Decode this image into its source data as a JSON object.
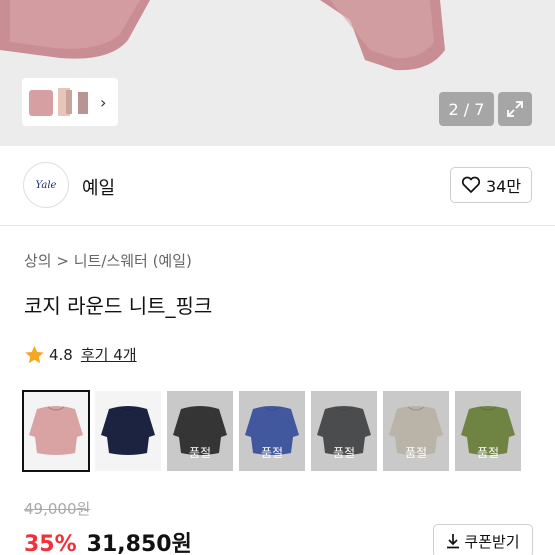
{
  "gallery": {
    "counter": "2 / 7",
    "thumbnail_next_icon": "chevron-right-icon",
    "expand_icon": "expand-icon"
  },
  "shop": {
    "logo_text": "Yale",
    "name": "예일",
    "like_count": "34만",
    "like_icon": "heart-outline-icon"
  },
  "breadcrumb": {
    "level1": "상의",
    "separator": ">",
    "level2": "니트/스웨터 (예일)"
  },
  "product": {
    "title": "코지 라운드 니트_핑크",
    "rating": "4.8",
    "review_label": "후기 4개",
    "star_icon": "star-icon"
  },
  "swatches": [
    {
      "color": "#d9a3a4",
      "sold_out": false,
      "selected": true,
      "label": ""
    },
    {
      "color": "#1c2340",
      "sold_out": false,
      "selected": false,
      "label": ""
    },
    {
      "color": "#121212",
      "sold_out": true,
      "selected": false,
      "label": "품절"
    },
    {
      "color": "#2447b3",
      "sold_out": true,
      "selected": false,
      "label": "품절"
    },
    {
      "color": "#333538",
      "sold_out": true,
      "selected": false,
      "label": "품절"
    },
    {
      "color": "#ddd3c2",
      "sold_out": true,
      "selected": false,
      "label": "품절"
    },
    {
      "color": "#6a8a26",
      "sold_out": true,
      "selected": false,
      "label": "품절"
    }
  ],
  "pricing": {
    "original": "49,000원",
    "discount": "35%",
    "price": "31,850원",
    "coupon_label": "쿠폰받기",
    "coupon_icon": "download-icon"
  },
  "colors": {
    "discount": "#f0313a",
    "star": "#f5a623"
  }
}
